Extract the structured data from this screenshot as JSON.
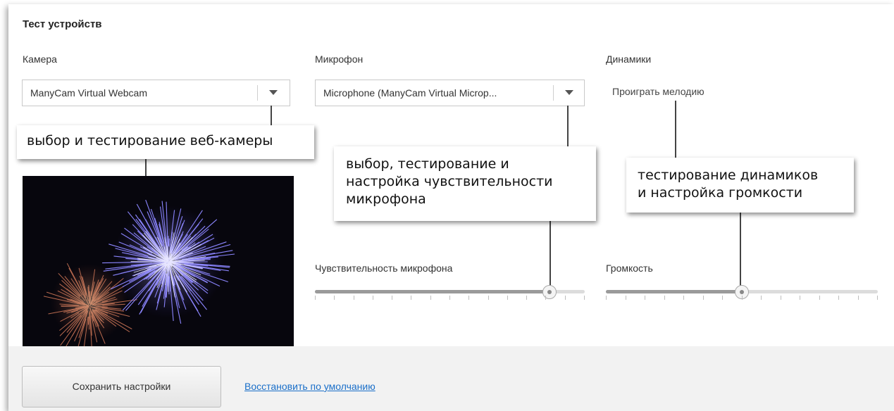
{
  "section_title": "Тест устройств",
  "camera": {
    "label": "Камера",
    "selected": "ManyCam Virtual Webcam"
  },
  "microphone": {
    "label": "Микрофон",
    "selected": "Microphone (ManyCam Virtual Microp...",
    "sensitivity_label": "Чувствительность микрофона",
    "sensitivity_value": 0.87
  },
  "speakers": {
    "label": "Динамики",
    "play_melody": "Проиграть мелодию",
    "volume_label": "Громкость",
    "volume_value": 0.5
  },
  "callouts": {
    "camera": "выбор и тестирование веб-камеры",
    "microphone_line1": "выбор, тестирование и",
    "microphone_line2": "настройка чувствительности",
    "microphone_line3": "микрофона",
    "speakers_line1": "тестирование динамиков",
    "speakers_line2": "и настройка громкости"
  },
  "footer": {
    "save_label": "Сохранить настройки",
    "reset_label": "Восстановить по умолчанию"
  },
  "icons": {
    "dropdown": "chevron-down-icon"
  },
  "colors": {
    "link": "#1a6fc9",
    "footer_bg": "#f2f2f2"
  }
}
